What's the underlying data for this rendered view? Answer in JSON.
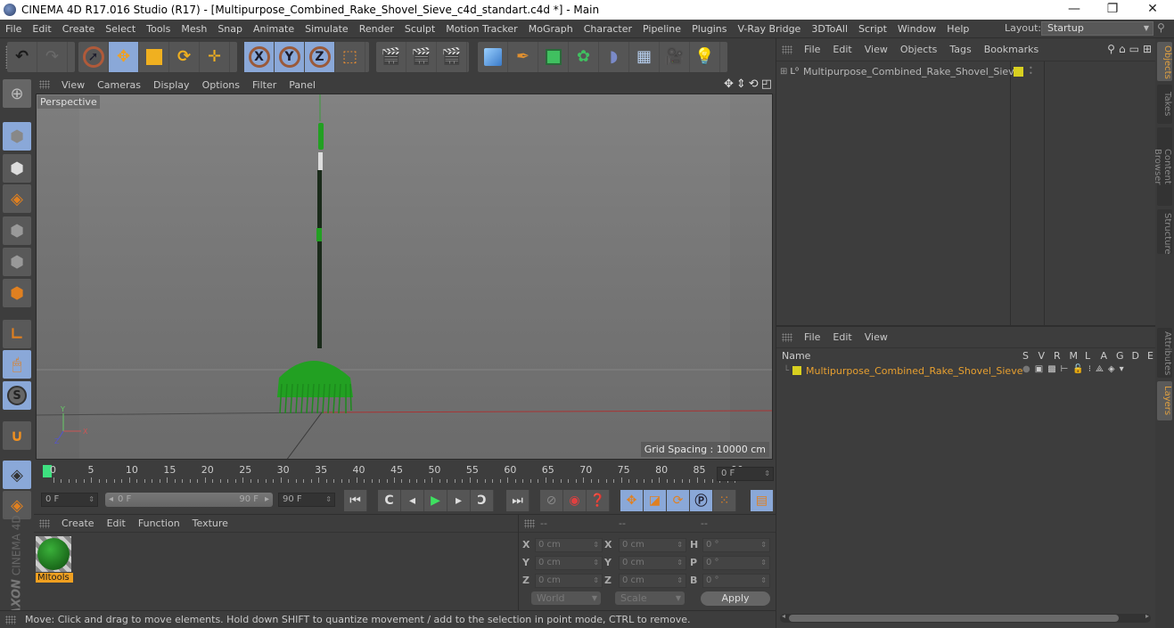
{
  "window": {
    "title": "CINEMA 4D R17.016 Studio (R17) - [Multipurpose_Combined_Rake_Shovel_Sieve_c4d_standart.c4d *] - Main",
    "controls": {
      "minimize": "—",
      "restore": "❐",
      "close": "✕"
    }
  },
  "menubar": {
    "items": [
      "File",
      "Edit",
      "Create",
      "Select",
      "Tools",
      "Mesh",
      "Snap",
      "Animate",
      "Simulate",
      "Render",
      "Sculpt",
      "Motion Tracker",
      "MoGraph",
      "Character",
      "Pipeline",
      "Plugins",
      "V-Ray Bridge",
      "3DToAll",
      "Script",
      "Window",
      "Help"
    ],
    "layout_label": "Layout:",
    "layout_value": "Startup"
  },
  "toolbar": {
    "groups": [
      {
        "tools": [
          {
            "name": "undo",
            "icon": "↶"
          },
          {
            "name": "redo",
            "icon": "↷"
          }
        ]
      },
      {
        "tools": [
          {
            "name": "live-selection",
            "icon": "➚"
          },
          {
            "name": "move",
            "icon": "✥",
            "selected": true
          },
          {
            "name": "scale",
            "icon": "◪"
          },
          {
            "name": "rotate",
            "icon": "⟳"
          },
          {
            "name": "last-tool",
            "icon": "✛"
          }
        ]
      },
      {
        "tools": [
          {
            "name": "x-axis",
            "icon": "X",
            "selected": true
          },
          {
            "name": "y-axis",
            "icon": "Y",
            "selected": true
          },
          {
            "name": "z-axis",
            "icon": "Z",
            "selected": true
          },
          {
            "name": "coordinate-system",
            "icon": "⬚"
          }
        ]
      },
      {
        "tools": [
          {
            "name": "render-view",
            "icon": "🎬"
          },
          {
            "name": "render-to-picture-viewer",
            "icon": "🎬"
          },
          {
            "name": "render-settings",
            "icon": "🎬"
          }
        ]
      },
      {
        "tools": [
          {
            "name": "cube",
            "icon": "◆"
          },
          {
            "name": "pen",
            "icon": "✒"
          },
          {
            "name": "subdivision",
            "icon": "◈"
          },
          {
            "name": "cloner",
            "icon": "✿"
          },
          {
            "name": "deformer",
            "icon": "◗"
          },
          {
            "name": "floor",
            "icon": "▦"
          },
          {
            "name": "camera",
            "icon": "🎥"
          },
          {
            "name": "light",
            "icon": "💡"
          }
        ]
      }
    ]
  },
  "left_tools": [
    "make-editable",
    "texture-mode",
    "workplane",
    "points-mode",
    "edges-mode",
    "polygons-mode",
    "axis-mode",
    "tweak-mode",
    "snap-settings",
    "magnet",
    "locked-workplane",
    "planar-workplane"
  ],
  "viewport": {
    "menu": [
      "View",
      "Cameras",
      "Display",
      "Options",
      "Filter",
      "Panel"
    ],
    "camera_label": "Perspective",
    "grid_spacing": "Grid Spacing : 10000 cm",
    "axis_labels": {
      "y": "Y",
      "x": "X",
      "z": "Z"
    }
  },
  "timeline": {
    "ticks": [
      "0",
      "5",
      "10",
      "15",
      "20",
      "25",
      "30",
      "35",
      "40",
      "45",
      "50",
      "55",
      "60",
      "65",
      "70",
      "75",
      "80",
      "85",
      "90"
    ],
    "current_frame": "0 F",
    "start_field": "0 F",
    "range_start": "0 F",
    "range_end": "90 F",
    "end_field": "90 F"
  },
  "playback": {
    "buttons": [
      "go-to-start",
      "previous-key",
      "previous-frame",
      "play",
      "next-frame",
      "next-key",
      "go-to-end"
    ],
    "key_buttons": [
      "autokey-off",
      "record",
      "autokey-help"
    ],
    "mode_buttons": [
      "key-position",
      "key-scale",
      "key-rotation",
      "key-parameter",
      "key-pla"
    ],
    "timeline_button": "timeline"
  },
  "materials": {
    "menu": [
      "Create",
      "Edit",
      "Function",
      "Texture"
    ],
    "items": [
      {
        "name": "MItools",
        "color": "#1f8a2a"
      }
    ]
  },
  "coordinates": {
    "header": [
      "--",
      "--",
      "--"
    ],
    "rows": [
      {
        "l1": "X",
        "v1": "0 cm",
        "l2": "X",
        "v2": "0 cm",
        "l3": "H",
        "v3": "0 °"
      },
      {
        "l1": "Y",
        "v1": "0 cm",
        "l2": "Y",
        "v2": "0 cm",
        "l3": "P",
        "v3": "0 °"
      },
      {
        "l1": "Z",
        "v1": "0 cm",
        "l2": "Z",
        "v2": "0 cm",
        "l3": "B",
        "v3": "0 °"
      }
    ],
    "space": "World",
    "mode": "Scale",
    "apply": "Apply"
  },
  "objects_panel": {
    "menu": [
      "File",
      "Edit",
      "View",
      "Objects",
      "Tags",
      "Bookmarks"
    ],
    "objects": [
      {
        "name": "Multipurpose_Combined_Rake_Shovel_Sieve",
        "color": "#d8d020"
      }
    ]
  },
  "layers_panel": {
    "menu": [
      "File",
      "Edit",
      "View"
    ],
    "columns": [
      "Name",
      "S",
      "V",
      "R",
      "M",
      "L",
      "A",
      "G",
      "D",
      "E"
    ],
    "layers": [
      {
        "name": "Multipurpose_Combined_Rake_Shovel_Sieve",
        "color": "#d8d020"
      }
    ]
  },
  "side_tabs": {
    "top": [
      {
        "label": "Objects",
        "active": true
      },
      {
        "label": "Takes"
      },
      {
        "label": "Content Browser"
      },
      {
        "label": "Structure"
      }
    ],
    "bottom": [
      {
        "label": "Attributes"
      },
      {
        "label": "Layers",
        "active": true
      }
    ]
  },
  "status": "Move: Click and drag to move elements. Hold down SHIFT to quantize movement / add to the selection in point mode, CTRL to remove.",
  "brand": {
    "maxon": "MAXON",
    "product": "CINEMA 4D"
  },
  "colors": {
    "accent": "#8aa8d8",
    "selection": "#e8a030",
    "object_green": "#22aa22"
  }
}
